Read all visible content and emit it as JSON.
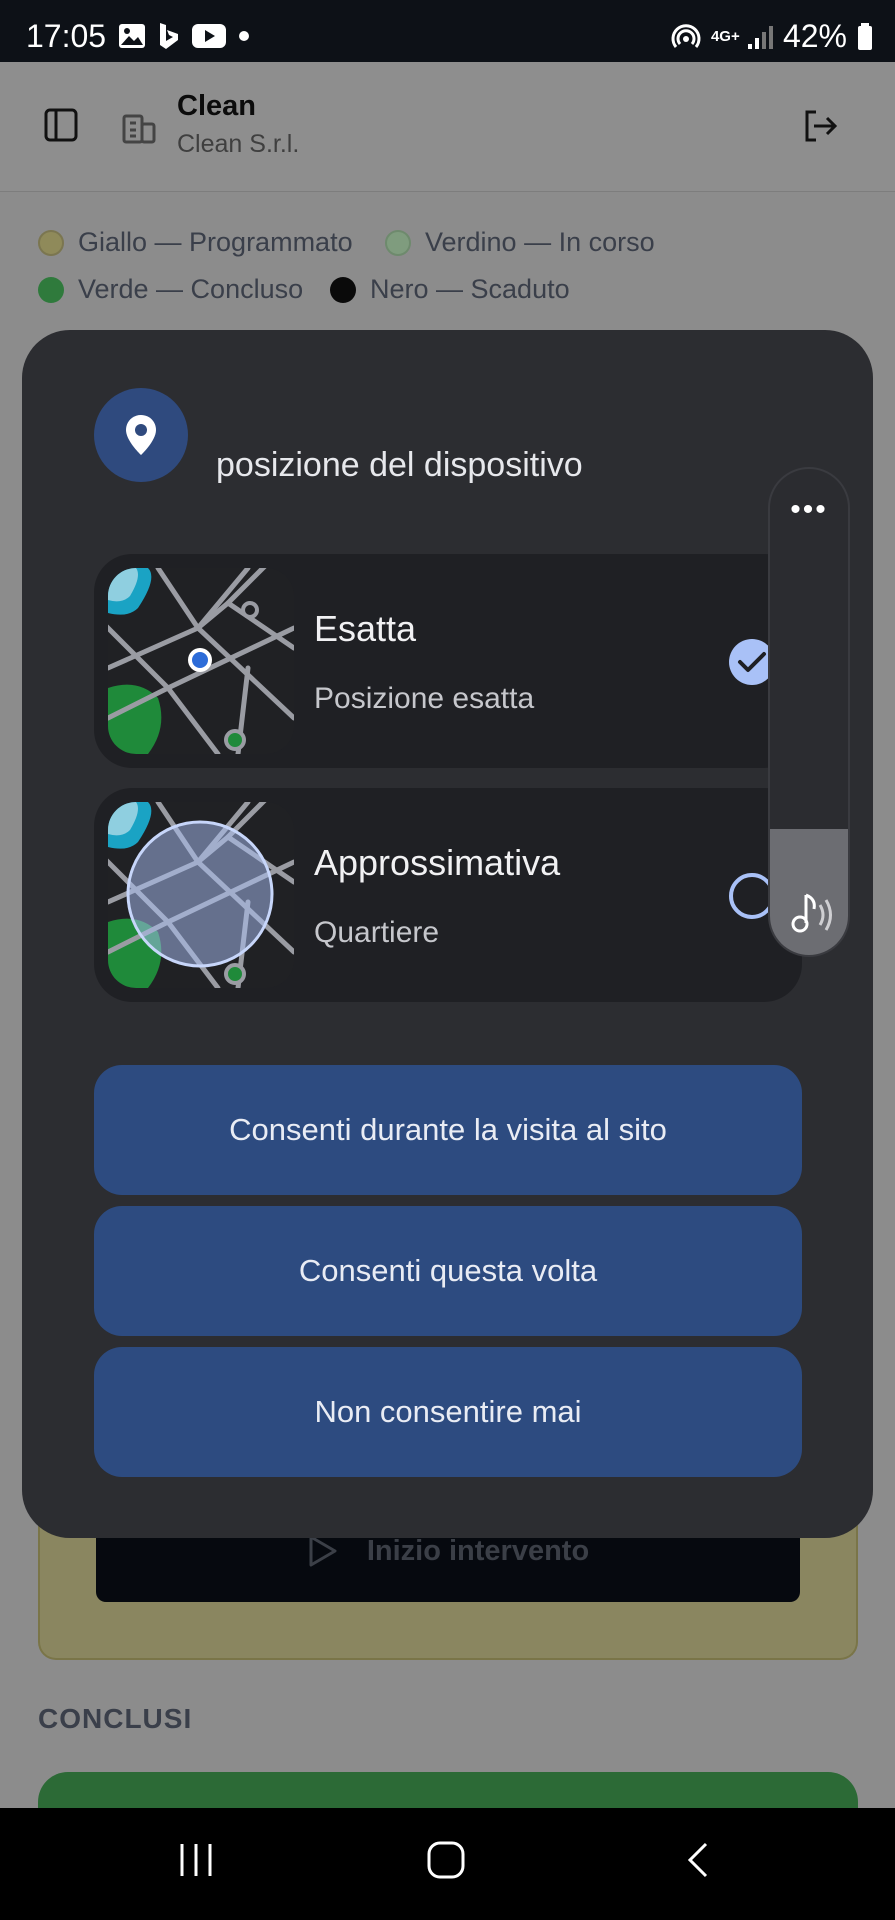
{
  "status_bar": {
    "time": "17:05",
    "battery": "42%",
    "network": "4G+"
  },
  "app": {
    "title": "Clean",
    "subtitle": "Clean S.r.l.",
    "legend": [
      {
        "label": "Giallo — Programmato",
        "color": "#8f8a5a"
      },
      {
        "label": "Verdino — In corso",
        "color": "#7f9c7e"
      },
      {
        "label": "Verde — Concluso",
        "color": "#2f7a3c"
      },
      {
        "label": "Nero — Scaduto",
        "color": "#0a0a0a"
      }
    ],
    "start_button": "Inizio intervento",
    "section_concluded": "CONCLUSI"
  },
  "dialog": {
    "title": "posizione del dispositivo",
    "options": [
      {
        "label": "Esatta",
        "description": "Posizione esatta",
        "selected": true
      },
      {
        "label": "Approssimativa",
        "description": "Quartiere",
        "selected": false
      }
    ],
    "buttons": {
      "allow_visit": "Consenti durante la visita al sito",
      "allow_once": "Consenti questa volta",
      "never": "Non consentire mai"
    }
  },
  "volume_panel": {
    "more_label": "•••",
    "level": 0.26
  },
  "colors": {
    "dialog_bg": "#2c2d31",
    "button_bg": "#2d4b80",
    "accent": "#a9c1f7"
  }
}
